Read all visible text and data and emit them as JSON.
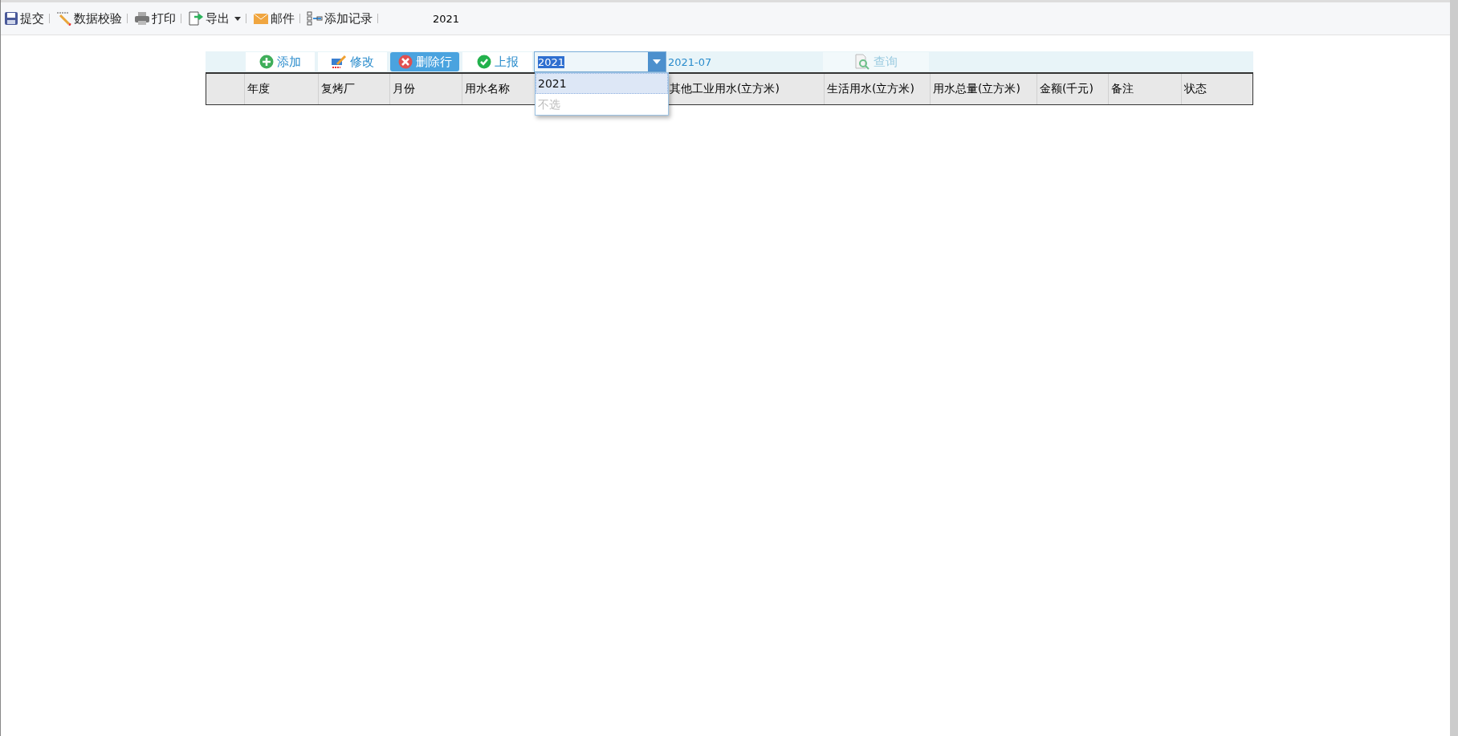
{
  "toolbar": {
    "items": [
      {
        "kind": "save",
        "label": "提交"
      },
      {
        "kind": "pencil",
        "label": "数据校验"
      },
      {
        "kind": "print",
        "label": "打印"
      },
      {
        "kind": "export",
        "label": "导出",
        "dropdown": true
      },
      {
        "kind": "mail",
        "label": "邮件"
      },
      {
        "kind": "record",
        "label": "添加记录"
      }
    ],
    "year": "2021"
  },
  "actions": [
    {
      "kind": "add",
      "label": "添加"
    },
    {
      "kind": "edit",
      "label": "修改"
    },
    {
      "kind": "delete",
      "label": "删除行"
    },
    {
      "kind": "report",
      "label": "上报"
    }
  ],
  "year_select": {
    "value": "2021",
    "expanded": true,
    "options": [
      {
        "label": "2021",
        "selected": true,
        "kind": "value"
      },
      {
        "label": "不选",
        "selected": false,
        "kind": "empty"
      }
    ]
  },
  "month": "2021-07",
  "query": {
    "label": "查询",
    "disabled": true
  },
  "table": {
    "columns": [
      "",
      "年度",
      "复烤厂",
      "月份",
      "用水名称",
      "",
      "其他工业用水(立方米)",
      "生活用水(立方米)",
      "用水总量(立方米)",
      "金额(千元)",
      "备注",
      "状态"
    ]
  }
}
